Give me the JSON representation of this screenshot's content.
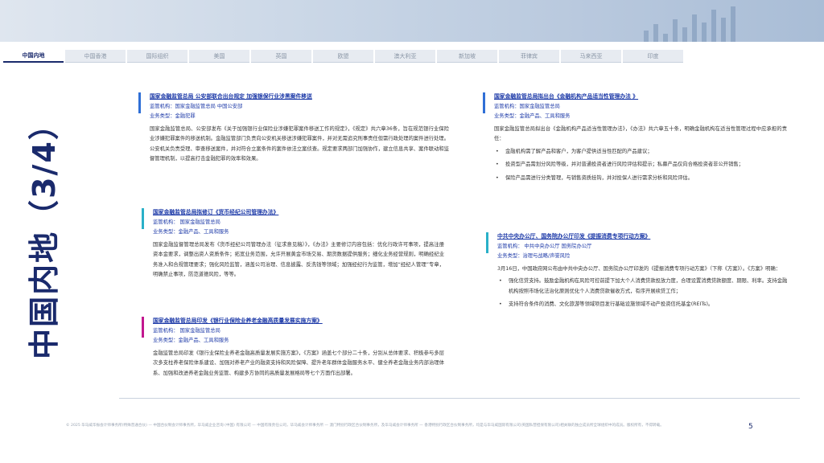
{
  "tabs": [
    {
      "label": "中国内地",
      "active": true
    },
    {
      "label": "中国香港"
    },
    {
      "label": "国际组织"
    },
    {
      "label": "美国"
    },
    {
      "label": "英国"
    },
    {
      "label": "欧盟"
    },
    {
      "label": "澳大利亚"
    },
    {
      "label": "新加坡"
    },
    {
      "label": "菲律宾"
    },
    {
      "label": "马来西亚"
    },
    {
      "label": "印度"
    }
  ],
  "side_title": "中国内地（3/4）",
  "cards": [
    {
      "accent": "#2f6fd6",
      "headline": "国家金融监管总局 公安部联合出台规定 加强银保行业涉黑案件移送",
      "regulator": "监管机构：国家金融监管总局 中国公安部",
      "category": "业务类型：金融犯罪",
      "body": "国家金融监管总局、公安部发布《关于加强银行业保险业涉嫌犯罪案件移送工作的规定》，《规定》共六章36条，旨在规范银行业保险业涉嫌犯罪案件的移送机制。金融监管部门负责向公安机关移送涉嫌犯罪案件，并对无需追究刑事责任但需行政处理的案件进行处理。公安机关负责受理、审查移送案件，并对符合立案条件的案件依法立案侦查。规定要求两部门加强协作，建立信息共享、案件联动和监督管理机制，以提高打击金融犯罪的效率和效果。"
    },
    {
      "accent": "#2ab0c8",
      "headline": "国家金融监管总局拟修订《货币经纪公司管理办法》",
      "regulator": "监管机构：  国家金融监管总局",
      "category": "业务类型：金融产品、工具和服务",
      "body": "国家金融监督管理总局发布《货币经纪公司管理办法（征求意见稿）》，《办法》主要修订内容包括：优化行政许可事项，提高注册资本金要求，调整出资人资质条件；拓宽业务范围，允许开展黄金市场交易、期货数据提供服务；细化业务经营规则，明确经纪业务准入和合规管理要求；强化风险监管，涵盖公司治理、信息披露、反洗钱等领域；加强经纪行为监管，增加“经纪人管理”专章，明确禁止事项，防范道德风险，等等。"
    },
    {
      "accent": "#c2188f",
      "headline": "国家金融监管总局印发《银行业保险业养老金融高质量发展实施方案》",
      "regulator": "监管机构：  国家金融监管总局",
      "category": "业务类型：金融产品、工具和服务",
      "body": "金融监管总局印发《银行业保险业养老金融高质量发展实施方案》，《方案》涵盖七个部分二十条，分别从总体要求、积极参与多层次多支柱养老保险体系建设、加强对养老产业的融资支持和风险保障、提升老年群体金融服务水平、健全养老金融业务内部治理体系、加强和改进养老金融业务监管、构建多方协同的高质量发展格局等七个方面作出部署。"
    },
    {
      "accent": "#2f6fd6",
      "headline": "国家金融监管总局拟出台《金融机构产品适当性管理办法 》",
      "regulator": "监管机构：国家金融监管总局",
      "category": "业务类型：金融产品、工具和服务",
      "body": "国家金融监管总局拟出台《金融机构产品适当性管理办法》，《办法》共六章五十条，明确金融机构在适当性管理过程中应承担的责任：",
      "bullets": [
        "金融机构需了解产品和客户，为客户提供适当性匹配的产品建议；",
        "投资型产品需划分风险等级，并对普通投资者进行风险评估和提示；私募产品仅向合格投资者非公开销售；",
        "保险产品需进行分类管理，与销售资质挂钩，并对投保人进行需求分析和风险评估。"
      ]
    },
    {
      "accent": "#2ab0c8",
      "headline": "中共中央办公厅、国务院办公厅印发《提振消费专项行动方案》",
      "regulator": "监管机构：  中共中央办公厅 国务院办公厅",
      "category": "业务类型：治理与战略/声誉风险",
      "body": "3月16日，中国政府网公布由中共中央办公厅、国务院办公厅印发的《提振消费专项行动方案》（下称《方案》）。《方案》明确：",
      "bullets": [
        "强化信贷支持。鼓励金融机构在风险可控前提下加大个人消费贷款投放力度，合理设置消费贷款额度、期限、利率。支持金融机构按照市场化法治化原则优化个人消费贷款催收方式，有序开展续贷工作；",
        "支持符合条件的消费、文化旅游等领域项目发行基础设施领域不动产投资信托基金(REITs)。"
      ]
    }
  ],
  "footer": "© 2025 毕马威华振会计师事务所(特殊普通合伙) — 中国合伙制会计师事务所，毕马威企业咨询 (中国) 有限公司 — 中国有限责任公司，毕马威会计师事务所 — 澳门特别行政区合伙制事务所，及毕马威会计师事务所 — 香港特别行政区合伙制事务所，均是与毕马威国际有限公司(英国私营担保有限公司)相关联的独立成员所全球组织中的成员。版权所有，不得转载。",
  "page_number": "5"
}
